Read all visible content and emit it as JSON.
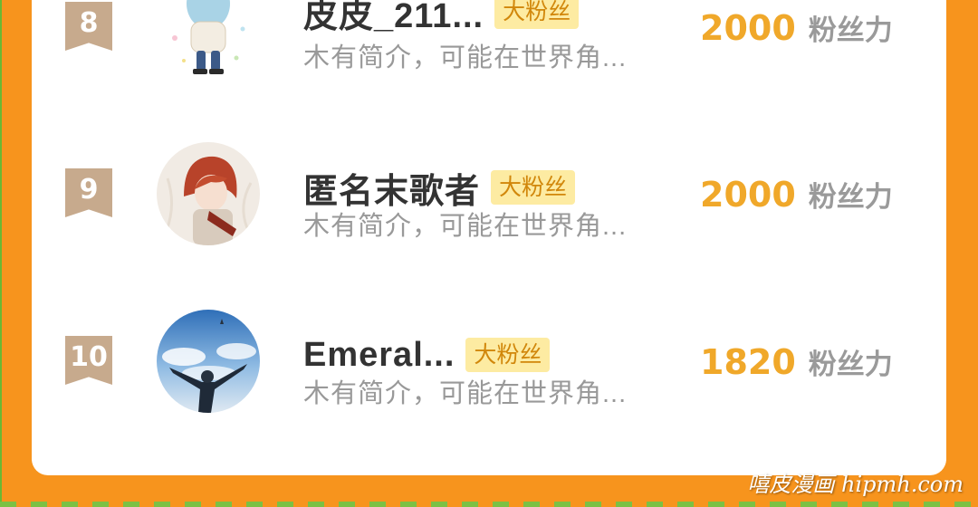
{
  "ranking": {
    "items": [
      {
        "rank": "8",
        "name": "皮皮_211...",
        "tag": "大粉丝",
        "description": "木有简介，可能在世界角...",
        "score": "2000",
        "score_unit": "粉丝力",
        "avatar_icon": "avatar-illustrated-child"
      },
      {
        "rank": "9",
        "name": "匿名末歌者",
        "tag": "大粉丝",
        "description": "木有简介，可能在世界角...",
        "score": "2000",
        "score_unit": "粉丝力",
        "avatar_icon": "avatar-red-haired-character"
      },
      {
        "rank": "10",
        "name": "Emeral...",
        "tag": "大粉丝",
        "description": "木有简介，可能在世界角...",
        "score": "1820",
        "score_unit": "粉丝力",
        "avatar_icon": "avatar-sky-figure"
      }
    ]
  },
  "watermark": "嘻皮漫画 hipmh.com",
  "colors": {
    "background": "#f7941d",
    "card": "#ffffff",
    "rank_badge": "#c7aa8d",
    "tag_bg": "#fdeba2",
    "tag_text": "#d1870b",
    "score": "#f0a82a",
    "name": "#333333",
    "description": "#999999"
  }
}
